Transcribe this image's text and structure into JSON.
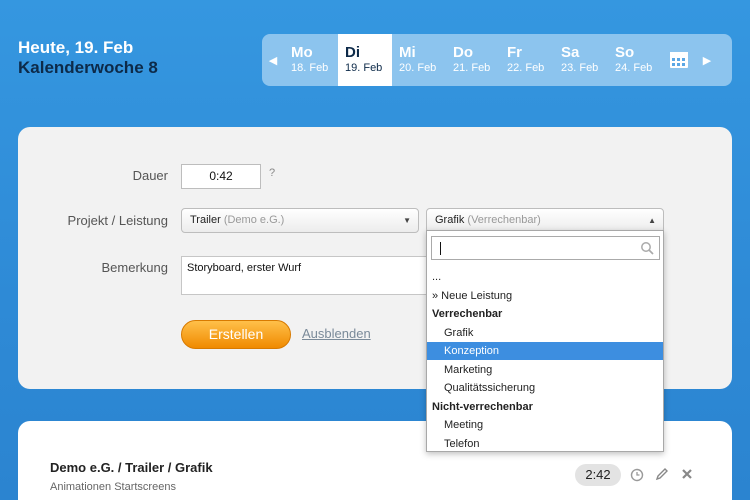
{
  "header": {
    "today": "Heute, 19. Feb",
    "week": "Kalenderwoche 8"
  },
  "days": [
    {
      "name": "Mo",
      "date": "18. Feb",
      "active": false
    },
    {
      "name": "Di",
      "date": "19. Feb",
      "active": true
    },
    {
      "name": "Mi",
      "date": "20. Feb",
      "active": false
    },
    {
      "name": "Do",
      "date": "21. Feb",
      "active": false
    },
    {
      "name": "Fr",
      "date": "22. Feb",
      "active": false
    },
    {
      "name": "Sa",
      "date": "23. Feb",
      "active": false
    },
    {
      "name": "So",
      "date": "24. Feb",
      "active": false
    }
  ],
  "form": {
    "duration_label": "Dauer",
    "duration_value": "0:42",
    "help": "?",
    "project_label": "Projekt / Leistung",
    "project_value": "Trailer",
    "project_client": "(Demo e.G.)",
    "service_value": "Grafik",
    "service_note": "(Verrechenbar)",
    "notes_label": "Bemerkung",
    "notes_value": "Storyboard, erster Wurf",
    "create_button": "Erstellen",
    "hide_link": "Ausblenden"
  },
  "dropdown": {
    "options": [
      {
        "label": "...",
        "type": "item",
        "indent": false,
        "highlight": false
      },
      {
        "label": "» Neue Leistung",
        "type": "item",
        "indent": false,
        "highlight": false
      },
      {
        "label": "Verrechenbar",
        "type": "group",
        "indent": false,
        "highlight": false
      },
      {
        "label": "Grafik",
        "type": "item",
        "indent": true,
        "highlight": false
      },
      {
        "label": "Konzeption",
        "type": "item",
        "indent": true,
        "highlight": true
      },
      {
        "label": "Marketing",
        "type": "item",
        "indent": true,
        "highlight": false
      },
      {
        "label": "Qualitätssicherung",
        "type": "item",
        "indent": true,
        "highlight": false
      },
      {
        "label": "Nicht-verrechenbar",
        "type": "group",
        "indent": false,
        "highlight": false
      },
      {
        "label": "Meeting",
        "type": "item",
        "indent": true,
        "highlight": false
      },
      {
        "label": "Telefon",
        "type": "item",
        "indent": true,
        "highlight": false
      }
    ]
  },
  "entry": {
    "title": "Demo e.G. / Trailer / Grafik",
    "subtitle": "Animationen Startscreens",
    "time": "2:42"
  },
  "colors": {
    "accent": "#2f8fd9",
    "highlight": "#3d8ee0",
    "button": "#f5a623"
  },
  "icons": [
    "chevron-left-icon",
    "chevron-right-icon",
    "calendar-icon",
    "search-icon",
    "clock-icon",
    "pencil-icon",
    "close-icon"
  ]
}
